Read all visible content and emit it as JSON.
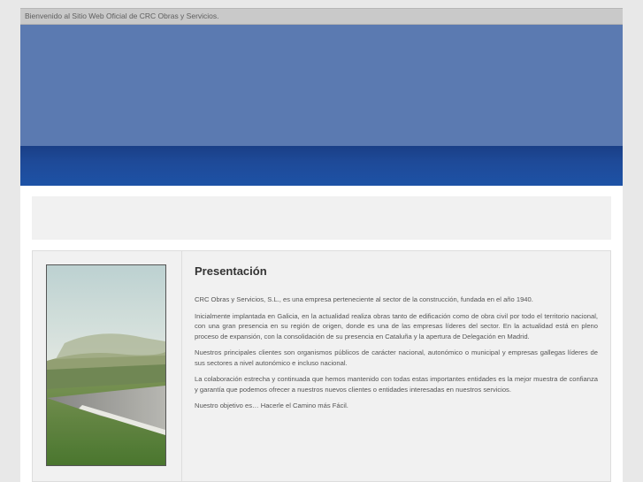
{
  "header": {
    "welcome": "Bienvenido al Sitio Web Oficial de CRC Obras y Servicios."
  },
  "colors": {
    "banner_top": "#5b7ab1",
    "banner_bottom": "#1d4b9c",
    "panel": "#f1f1f1"
  },
  "content": {
    "title": "Presentación",
    "paragraphs": [
      "CRC Obras y Servicios, S.L., es una empresa perteneciente al sector de la construcción, fundada en el año 1940.",
      "Inicialmente implantada en Galicia, en la actualidad realiza obras tanto de edificación como de obra civil por todo el territorio nacional, con una gran presencia en su región de origen, donde es una de las empresas líderes del sector. En la actualidad está en pleno proceso de expansión, con la consolidación de su presencia en Cataluña y la apertura de Delegación en Madrid.",
      "Nuestros principales clientes son organismos públicos de carácter nacional, autonómico o municipal y empresas gallegas líderes de sus sectores a nivel autonómico e incluso nacional.",
      "La colaboración estrecha y continuada que hemos mantenido con todas estas importantes entidades es la mejor muestra de confianza y garantía que podemos ofrecer a nuestros nuevos clientes o entidades interesadas en nuestros servicios.",
      "Nuestro objetivo es… Hacerle el Camino más Fácil."
    ]
  }
}
